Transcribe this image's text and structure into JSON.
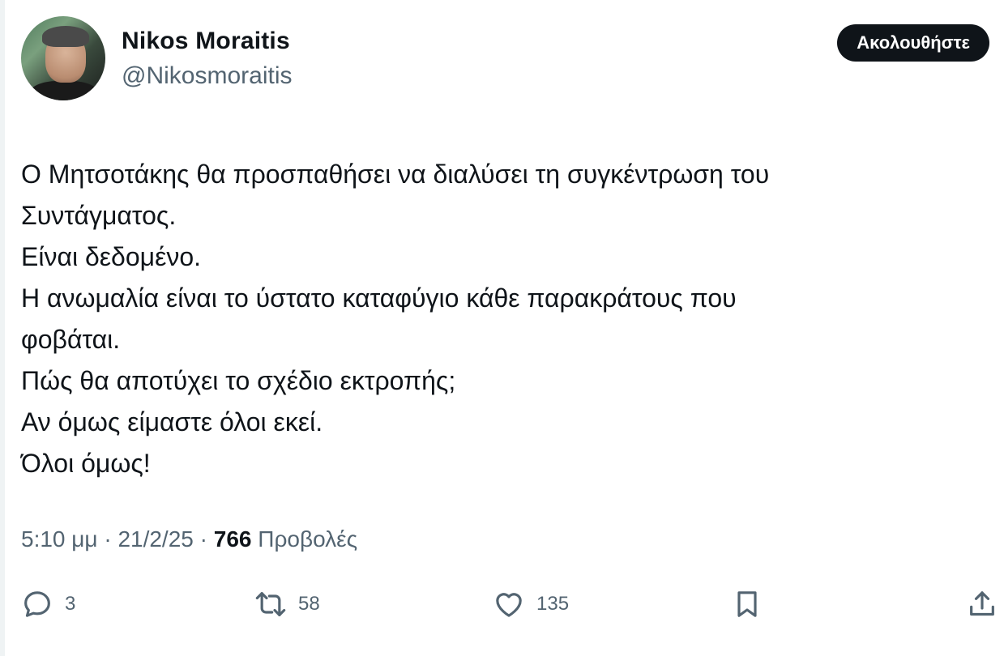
{
  "author": {
    "name": "Nikos Moraitis",
    "handle": "@Nikosmoraitis"
  },
  "follow_label": "Ακολουθήστε",
  "tweet_text": "Ο Μητσοτάκης θα προσπαθήσει να διαλύσει τη συγκέντρωση του\nΣυντάγματος.\nΕίναι δεδομένο.\nΗ ανωμαλία είναι το ύστατο καταφύγιο κάθε παρακράτους που\nφοβάται.\nΠώς θα αποτύχει το σχέδιο εκτροπής;\nΑν όμως είμαστε όλοι εκεί.\nΌλοι όμως!",
  "meta": {
    "time": "5:10 μμ",
    "separator": " · ",
    "date": "21/2/25",
    "views_count": "766",
    "views_label": " Προβολές"
  },
  "actions": {
    "reply": {
      "icon": "reply-icon",
      "count": "3"
    },
    "retweet": {
      "icon": "retweet-icon",
      "count": "58"
    },
    "like": {
      "icon": "heart-icon",
      "count": "135"
    },
    "bookmark": {
      "icon": "bookmark-icon"
    },
    "share": {
      "icon": "share-icon"
    }
  },
  "colors": {
    "text": "#0f1419",
    "secondary": "#536471",
    "button_bg": "#0f1419",
    "button_text": "#ffffff"
  }
}
